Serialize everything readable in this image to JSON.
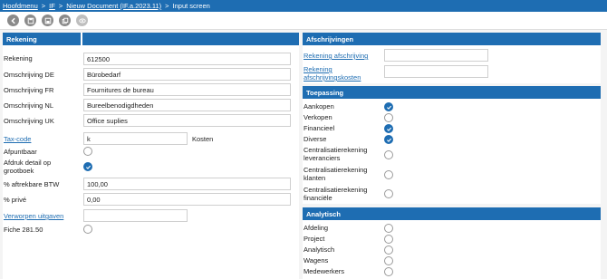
{
  "breadcrumb": {
    "items": [
      "Hoofdmenu",
      "IF",
      "Nieuw Document (IF.a.2023.11)"
    ],
    "current": "Input screen",
    "separator": ">"
  },
  "toolbar": {
    "icons": [
      "back-icon",
      "save-icon",
      "save-as-icon",
      "copy-icon",
      "view-icon"
    ]
  },
  "left": {
    "header_label": "Rekening",
    "fields": {
      "rekening": {
        "label": "Rekening",
        "value": "612500"
      },
      "omschr_de": {
        "label": "Omschrijving DE",
        "value": "Bürobedarf"
      },
      "omschr_fr": {
        "label": "Omschrijving FR",
        "value": "Fournitures de bureau"
      },
      "omschr_nl": {
        "label": "Omschrijving NL",
        "value": "Bureelbenodigdheden"
      },
      "omschr_uk": {
        "label": "Omschrijving UK",
        "value": "Office suplies"
      },
      "taxcode": {
        "label": "Tax-code",
        "value": "k",
        "extra": "Kosten"
      },
      "afpuntbaar": {
        "label": "Afpuntbaar",
        "checked": false
      },
      "afdruk": {
        "label": "Afdruk detail op grootboek",
        "checked": true
      },
      "aftrekbare": {
        "label": "% aftrekbare BTW",
        "value": "100,00"
      },
      "prive": {
        "label": "% privé",
        "value": "0,00"
      },
      "verworpen": {
        "label": "Verworpen uitgaven",
        "value": ""
      },
      "fiche": {
        "label": "Fiche 281.50",
        "checked": false
      }
    }
  },
  "afschrijvingen": {
    "header": "Afschrijvingen",
    "rekening_afschrijving": {
      "label": "Rekening afschrijving",
      "value": ""
    },
    "rekening_kosten": {
      "label": "Rekening afschrijvingskosten",
      "value": ""
    }
  },
  "toepassing": {
    "header": "Toepassing",
    "items": [
      {
        "label": "Aankopen",
        "checked": true
      },
      {
        "label": "Verkopen",
        "checked": false
      },
      {
        "label": "Financieel",
        "checked": true
      },
      {
        "label": "Diverse",
        "checked": true
      },
      {
        "label": "Centralisatierekening leveranciers",
        "checked": false
      },
      {
        "label": "Centralisatierekening klanten",
        "checked": false
      },
      {
        "label": "Centralisatierekening financiële",
        "checked": false
      }
    ]
  },
  "analytisch": {
    "header": "Analytisch",
    "items": [
      {
        "label": "Afdeling",
        "checked": false
      },
      {
        "label": "Project",
        "checked": false
      },
      {
        "label": "Analytisch",
        "checked": false
      },
      {
        "label": "Wagens",
        "checked": false
      },
      {
        "label": "Medewerkers",
        "checked": false
      }
    ]
  },
  "colors": {
    "accent": "#1e6db2",
    "link": "#1e6db2",
    "toolbar_icon": "#8a8a8a"
  }
}
